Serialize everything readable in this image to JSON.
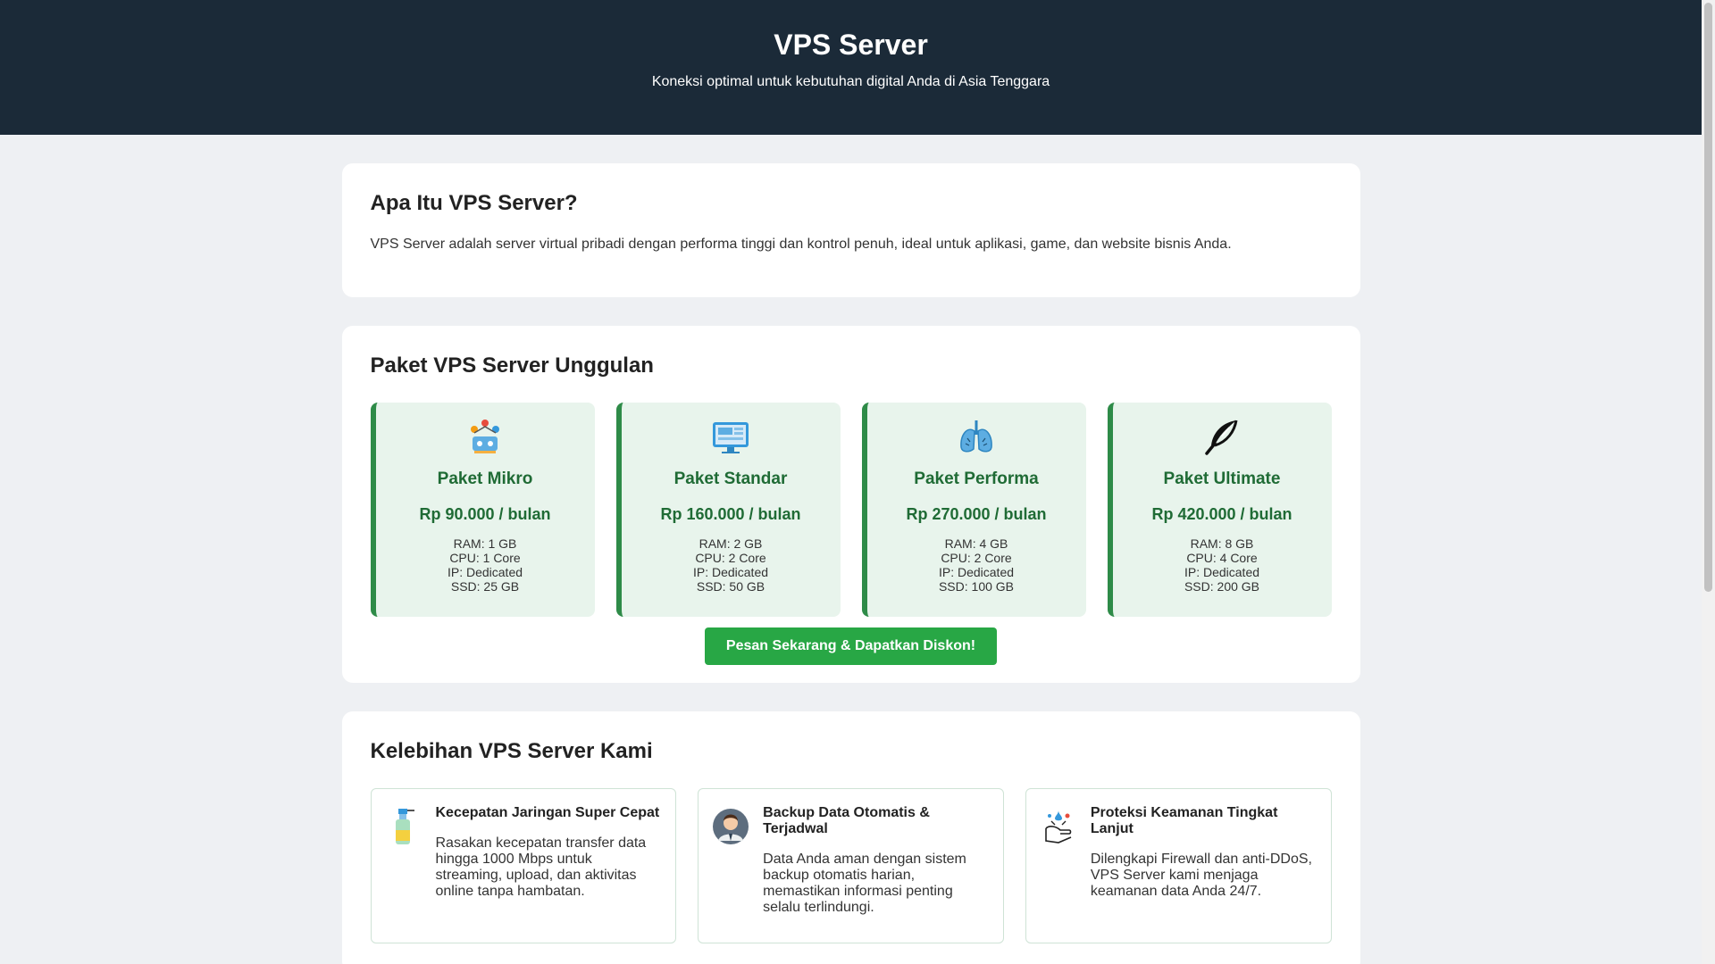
{
  "header": {
    "title": "VPS Server",
    "subtitle": "Koneksi optimal untuk kebutuhan digital Anda di Asia Tenggara"
  },
  "about": {
    "title": "Apa Itu VPS Server?",
    "text": "VPS Server adalah server virtual pribadi dengan performa tinggi dan kontrol penuh, ideal untuk aplikasi, game, dan website bisnis Anda."
  },
  "plans_section": {
    "title": "Paket VPS Server Unggulan",
    "plans": [
      {
        "icon": "people-network-icon",
        "name": "Paket Mikro",
        "price": "Rp 90.000 / bulan",
        "ram": "RAM: 1 GB",
        "cpu": "CPU: 1 Core",
        "ip": "IP: Dedicated",
        "ssd": "SSD: 25 GB"
      },
      {
        "icon": "monitor-icon",
        "name": "Paket Standar",
        "price": "Rp 160.000 / bulan",
        "ram": "RAM: 2 GB",
        "cpu": "CPU: 2 Core",
        "ip": "IP: Dedicated",
        "ssd": "SSD: 50 GB"
      },
      {
        "icon": "lungs-icon",
        "name": "Paket Performa",
        "price": "Rp 270.000 / bulan",
        "ram": "RAM: 4 GB",
        "cpu": "CPU: 2 Core",
        "ip": "IP: Dedicated",
        "ssd": "SSD: 100 GB"
      },
      {
        "icon": "feather-icon",
        "name": "Paket Ultimate",
        "price": "Rp 420.000 / bulan",
        "ram": "RAM: 8 GB",
        "cpu": "CPU: 4 Core",
        "ip": "IP: Dedicated",
        "ssd": "SSD: 200 GB"
      }
    ],
    "cta_label": "Pesan Sekarang & Dapatkan Diskon!"
  },
  "features_section": {
    "title": "Kelebihan VPS Server Kami",
    "features": [
      {
        "icon": "spray-bottle-icon",
        "title": "Kecepatan Jaringan Super Cepat",
        "text": "Rasakan kecepatan transfer data hingga 1000 Mbps untuk streaming, upload, dan aktivitas online tanpa hambatan."
      },
      {
        "icon": "person-avatar-icon",
        "title": "Backup Data Otomatis & Terjadwal",
        "text": "Data Anda aman dengan sistem backup otomatis harian, memastikan informasi penting selalu terlindungi."
      },
      {
        "icon": "hand-wash-icon",
        "title": "Proteksi Keamanan Tingkat Lanjut",
        "text": "Dilengkapi Firewall dan anti-DDoS, VPS Server kami menjaga keamanan data Anda 24/7."
      }
    ]
  },
  "colors": {
    "header_bg": "#1b2a38",
    "accent_green": "#28a745",
    "plan_bg": "#e8f4ec",
    "plan_text": "#1f6b35"
  }
}
